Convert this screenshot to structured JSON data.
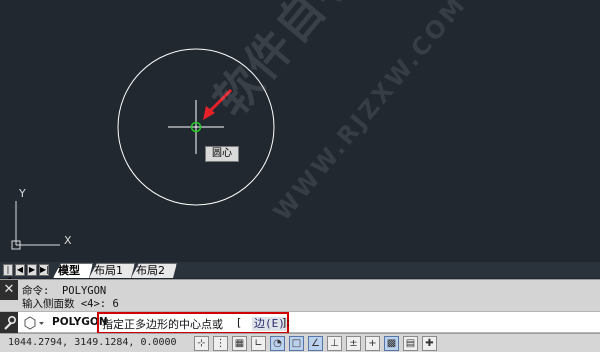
{
  "layout_tabs": [
    {
      "label": "模型",
      "active": true
    },
    {
      "label": "布局1",
      "active": false
    },
    {
      "label": "布局2",
      "active": false
    }
  ],
  "nav_buttons": [
    "first",
    "previous",
    "next",
    "last"
  ],
  "snap_tooltip": "圆心",
  "watermark": {
    "text": "软件自学网",
    "url": "WWW.RJZXW.COM"
  },
  "ucs": {
    "y_label": "Y",
    "x_label": "X"
  },
  "command_history": [
    {
      "label": "命令:",
      "value": "POLYGON"
    },
    {
      "label": "输入侧面数 <4>:",
      "value": "6"
    }
  ],
  "command_line": {
    "command": "POLYGON",
    "prompt": "指定正多边形的中心点或",
    "option_open": "[",
    "option": "边(E)",
    "suffix": "]:"
  },
  "status_bar": {
    "coordinates": "1044.2794, 3149.1284, 0.0000",
    "buttons": [
      {
        "icon": "infer-constraints-icon",
        "on": false
      },
      {
        "icon": "snap-mode-icon",
        "on": false
      },
      {
        "icon": "grid-display-icon",
        "on": false
      },
      {
        "icon": "ortho-mode-icon",
        "on": false
      },
      {
        "icon": "polar-tracking-icon",
        "on": true
      },
      {
        "icon": "object-snap-icon",
        "on": true
      },
      {
        "icon": "object-snap-tracking-icon",
        "on": true
      },
      {
        "icon": "dynamic-ucs-icon",
        "on": false
      },
      {
        "icon": "dynamic-input-icon",
        "on": false
      },
      {
        "icon": "lineweight-icon",
        "on": false
      },
      {
        "icon": "transparency-icon",
        "on": true
      },
      {
        "icon": "quick-properties-icon",
        "on": false
      },
      {
        "icon": "selection-cycling-icon",
        "on": false
      }
    ]
  },
  "colors": {
    "canvas_bg": "#212830",
    "circle": "#ffffff",
    "crosshair": "#ffffff",
    "snap_marker": "#22cc22",
    "arrow": "#e8202a",
    "highlight_box": "#d00000"
  }
}
